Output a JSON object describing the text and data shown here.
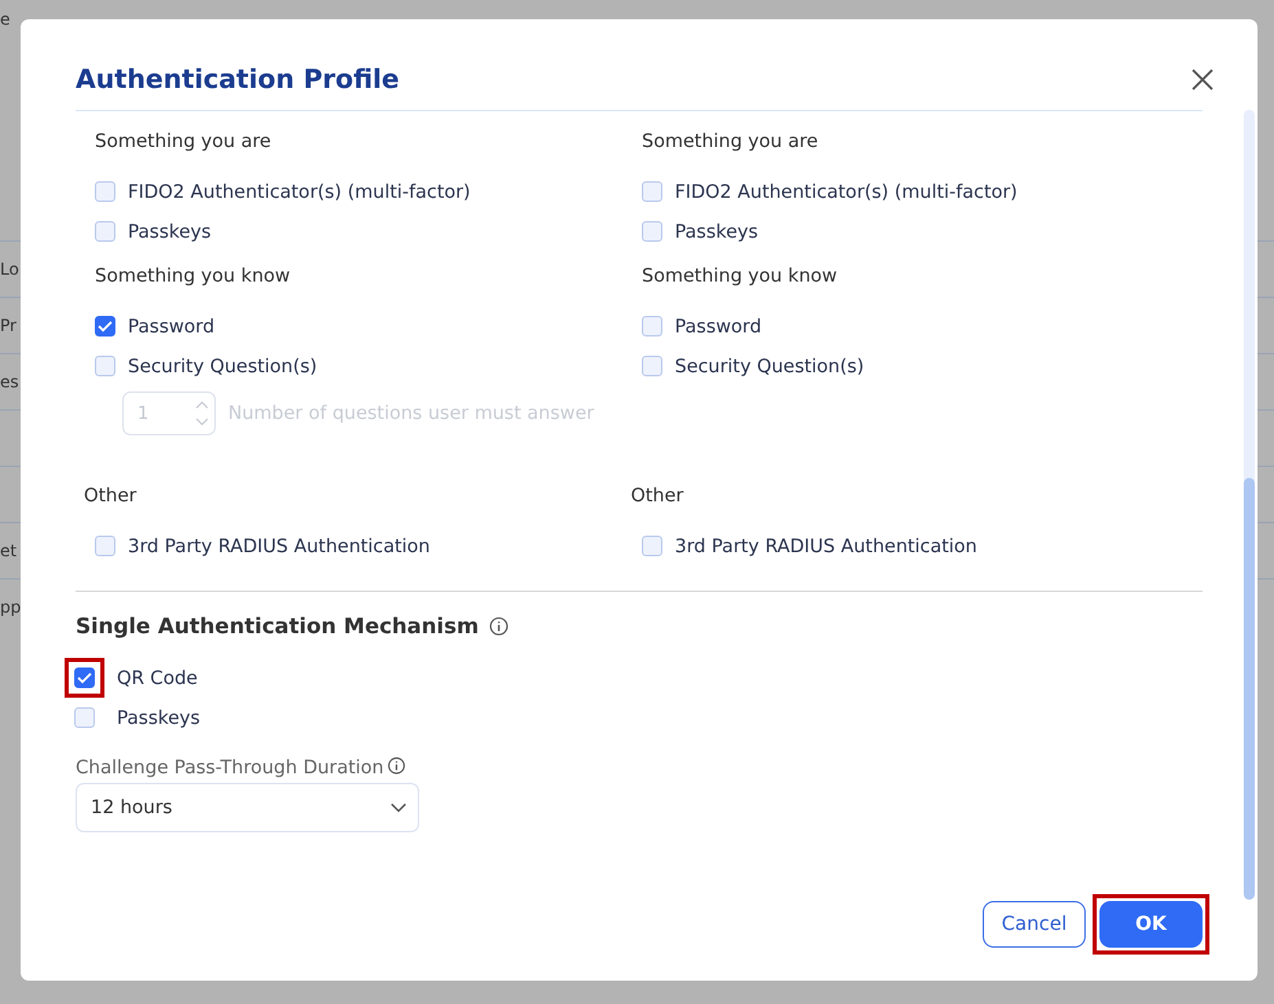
{
  "background": {
    "heading": "e",
    "rows": [
      "Lo",
      "Pr",
      "es",
      null,
      null,
      "et",
      "pp"
    ]
  },
  "dialog": {
    "title": "Authentication Profile",
    "columns": [
      {
        "groups": [
          {
            "heading": "Something you are",
            "options": [
              {
                "label": "FIDO2 Authenticator(s) (multi-factor)",
                "checked": false
              },
              {
                "label": "Passkeys",
                "checked": false
              }
            ]
          },
          {
            "heading": "Something you know",
            "options": [
              {
                "label": "Password",
                "checked": true
              },
              {
                "label": "Security Question(s)",
                "checked": false
              }
            ],
            "stepper": {
              "value": "1",
              "label": "Number of questions user must answer",
              "disabled": true
            }
          },
          {
            "heading": "Other",
            "options": [
              {
                "label": "3rd Party RADIUS Authentication",
                "checked": false
              }
            ]
          }
        ]
      },
      {
        "groups": [
          {
            "heading": "Something you are",
            "options": [
              {
                "label": "FIDO2 Authenticator(s) (multi-factor)",
                "checked": false
              },
              {
                "label": "Passkeys",
                "checked": false
              }
            ]
          },
          {
            "heading": "Something you know",
            "options": [
              {
                "label": "Password",
                "checked": false
              },
              {
                "label": "Security Question(s)",
                "checked": false
              }
            ]
          },
          {
            "heading": "Other",
            "options": [
              {
                "label": "3rd Party RADIUS Authentication",
                "checked": false
              }
            ]
          }
        ]
      }
    ],
    "single": {
      "heading": "Single Authentication Mechanism",
      "options": [
        {
          "label": "QR Code",
          "checked": true,
          "highlighted": true
        },
        {
          "label": "Passkeys",
          "checked": false,
          "highlighted": false
        }
      ]
    },
    "duration": {
      "label": "Challenge Pass-Through Duration",
      "value": "12 hours"
    },
    "buttons": [
      {
        "label": "Cancel",
        "kind": "secondary",
        "highlighted": false
      },
      {
        "label": "OK",
        "kind": "primary",
        "highlighted": true
      }
    ]
  }
}
